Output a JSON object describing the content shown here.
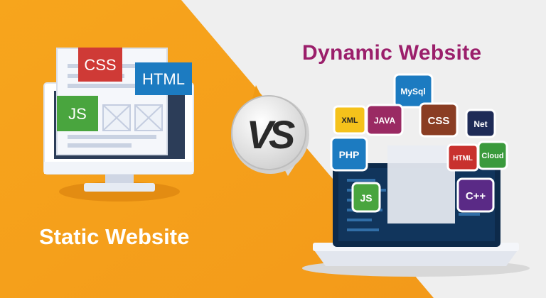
{
  "headings": {
    "dynamic": "Dynamic Website",
    "static": "Static Website"
  },
  "vs_label": "VS",
  "static_tags": {
    "css": "CSS",
    "html": "HTML",
    "js": "JS"
  },
  "dynamic_tags": {
    "mysql": "MySql",
    "xml": "XML",
    "java": "JAVA",
    "css": "CSS",
    "net": "Net",
    "php": "PHP",
    "html": "HTML",
    "cloud": "Cloud",
    "js": "JS",
    "cpp": "C++"
  },
  "colors": {
    "orange": "#f7a21b",
    "title_purple": "#9b1f6b",
    "css_red": "#cf3a36",
    "html_blue": "#1c7bc1",
    "js_green": "#49a53e"
  }
}
